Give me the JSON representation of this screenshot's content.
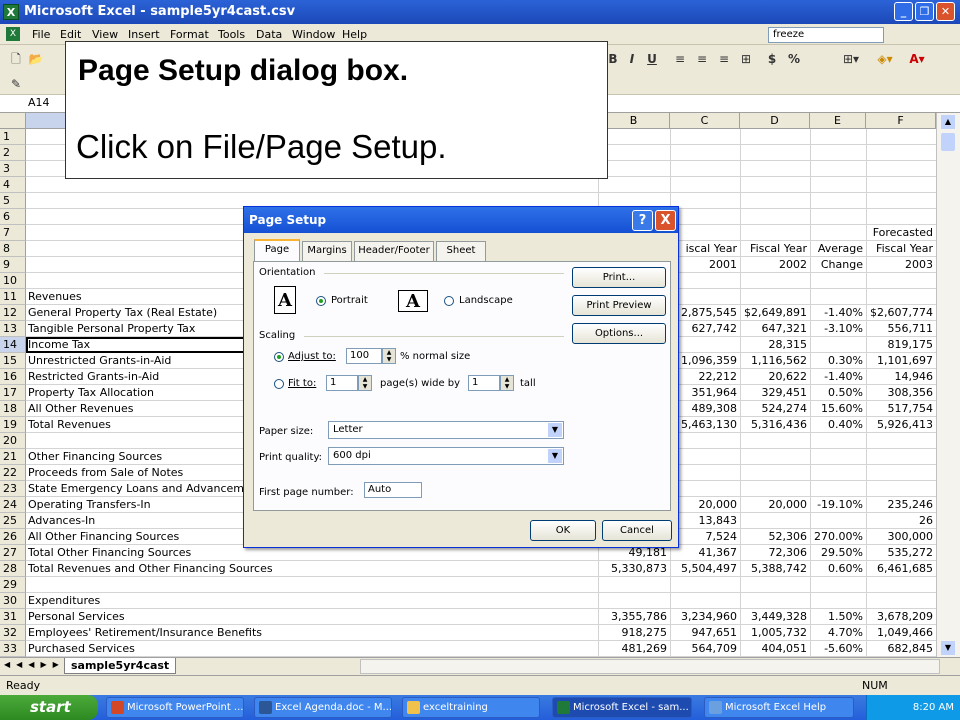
{
  "window": {
    "title": "Microsoft Excel - sample5yr4cast.csv",
    "app_icon": "X"
  },
  "menu": [
    "File",
    "Edit",
    "View",
    "Insert",
    "Format",
    "Tools",
    "Data",
    "Window",
    "Help"
  ],
  "help_box": "freeze",
  "toolbar": {
    "bold": "B",
    "italic": "I",
    "underline": "U",
    "currency": "$",
    "percent": "%"
  },
  "formula_bar": {
    "name_box": "A14"
  },
  "columns": [
    "B",
    "C",
    "D",
    "E",
    "F"
  ],
  "rows": [
    {
      "n": "1",
      "a": "",
      "b": "",
      "c": "",
      "d": "",
      "e": "",
      "f": ""
    },
    {
      "n": "2",
      "a": "",
      "b": "",
      "c": "",
      "d": "",
      "e": "",
      "f": ""
    },
    {
      "n": "3",
      "a": "",
      "b": "",
      "c": "",
      "d": "",
      "e": "",
      "f": ""
    },
    {
      "n": "4",
      "a": "",
      "b": "",
      "c": "",
      "d": "",
      "e": "",
      "f": ""
    },
    {
      "n": "5",
      "a": "",
      "b": "",
      "c": "",
      "d": "",
      "e": "",
      "f": ""
    },
    {
      "n": "6",
      "a": "",
      "b": "",
      "c": "",
      "d": "",
      "e": "",
      "f": ""
    },
    {
      "n": "7",
      "a": "",
      "b": "",
      "c": "",
      "d": "",
      "e": "",
      "f": "Forecasted"
    },
    {
      "n": "8",
      "a": "",
      "b": "",
      "c": "iscal Year",
      "d": "Fiscal Year",
      "e": "Average",
      "f": "Fiscal Year"
    },
    {
      "n": "9",
      "a": "",
      "b": "",
      "c": "2001",
      "d": "2002",
      "e": "Change",
      "f": "2003"
    },
    {
      "n": "10",
      "a": "",
      "b": "",
      "c": "",
      "d": "",
      "e": "",
      "f": ""
    },
    {
      "n": "11",
      "a": "Revenues",
      "b": "",
      "c": "",
      "d": "",
      "e": "",
      "f": ""
    },
    {
      "n": "12",
      "a": "General Property Tax (Real Estate)",
      "b": "",
      "c": "2,875,545",
      "d": "$2,649,891",
      "e": "-1.40%",
      "f": "$2,607,774"
    },
    {
      "n": "13",
      "a": "Tangible Personal Property Tax",
      "b": "",
      "c": "627,742",
      "d": "647,321",
      "e": "-3.10%",
      "f": "556,711"
    },
    {
      "n": "14",
      "a": "Income Tax",
      "b": "",
      "c": "",
      "d": "28,315",
      "e": "",
      "f": "819,175"
    },
    {
      "n": "15",
      "a": "Unrestricted Grants-in-Aid",
      "b": "",
      "c": "1,096,359",
      "d": "1,116,562",
      "e": "0.30%",
      "f": "1,101,697"
    },
    {
      "n": "16",
      "a": "Restricted Grants-in-Aid",
      "b": "",
      "c": "22,212",
      "d": "20,622",
      "e": "-1.40%",
      "f": "14,946"
    },
    {
      "n": "17",
      "a": "Property Tax Allocation",
      "b": "",
      "c": "351,964",
      "d": "329,451",
      "e": "0.50%",
      "f": "308,356"
    },
    {
      "n": "18",
      "a": "All Other Revenues",
      "b": "",
      "c": "489,308",
      "d": "524,274",
      "e": "15.60%",
      "f": "517,754"
    },
    {
      "n": "19",
      "a": "Total Revenues",
      "b": "",
      "c": "5,463,130",
      "d": "5,316,436",
      "e": "0.40%",
      "f": "5,926,413"
    },
    {
      "n": "20",
      "a": "",
      "b": "",
      "c": "",
      "d": "",
      "e": "",
      "f": ""
    },
    {
      "n": "21",
      "a": "Other Financing Sources",
      "b": "",
      "c": "",
      "d": "",
      "e": "",
      "f": ""
    },
    {
      "n": "22",
      "a": "Proceeds from Sale of Notes",
      "b": "",
      "c": "",
      "d": "",
      "e": "",
      "f": ""
    },
    {
      "n": "23",
      "a": "State Emergency Loans and Advancem",
      "b": "",
      "c": "",
      "d": "",
      "e": "",
      "f": ""
    },
    {
      "n": "24",
      "a": "Operating Transfers-In",
      "b": "",
      "c": "20,000",
      "d": "20,000",
      "e": "-19.10%",
      "f": "235,246"
    },
    {
      "n": "25",
      "a": "Advances-In",
      "b": "",
      "c": "13,843",
      "d": "",
      "e": "",
      "f": "26"
    },
    {
      "n": "26",
      "a": "All Other Financing Sources",
      "b": "",
      "c": "7,524",
      "d": "52,306",
      "e": "270.00%",
      "f": "300,000"
    },
    {
      "n": "27",
      "a": "Total Other Financing Sources",
      "b": "49,181",
      "c": "41,367",
      "d": "72,306",
      "e": "29.50%",
      "f": "535,272"
    },
    {
      "n": "28",
      "a": "Total Revenues and Other Financing Sources",
      "b": "5,330,873",
      "c": "5,504,497",
      "d": "5,388,742",
      "e": "0.60%",
      "f": "6,461,685"
    },
    {
      "n": "29",
      "a": "",
      "b": "",
      "c": "",
      "d": "",
      "e": "",
      "f": ""
    },
    {
      "n": "30",
      "a": "Expenditures",
      "b": "",
      "c": "",
      "d": "",
      "e": "",
      "f": ""
    },
    {
      "n": "31",
      "a": "Personal Services",
      "b": "3,355,786",
      "c": "3,234,960",
      "d": "3,449,328",
      "e": "1.50%",
      "f": "3,678,209"
    },
    {
      "n": "32",
      "a": "Employees' Retirement/Insurance Benefits",
      "b": "918,275",
      "c": "947,651",
      "d": "1,005,732",
      "e": "4.70%",
      "f": "1,049,466"
    },
    {
      "n": "33",
      "a": "Purchased Services",
      "b": "481,269",
      "c": "564,709",
      "d": "404,051",
      "e": "-5.60%",
      "f": "682,845"
    }
  ],
  "sheet_tab": "sample5yr4cast",
  "status": {
    "left": "Ready",
    "num": "NUM"
  },
  "annotation": {
    "title": "Page Setup dialog box.",
    "body": "Click on File/Page Setup."
  },
  "dialog": {
    "title": "Page Setup",
    "help_btn": "?",
    "close_btn": "X",
    "tabs": [
      "Page",
      "Margins",
      "Header/Footer",
      "Sheet"
    ],
    "orientation_label": "Orientation",
    "portrait": "Portrait",
    "landscape": "Landscape",
    "orient_glyph": "A",
    "scaling_label": "Scaling",
    "adjust_to": "Adjust to:",
    "adjust_value": "100",
    "normal_size": "% normal size",
    "fit_to": "Fit to:",
    "fit_wide": "1",
    "pages_wide_by": "page(s) wide by",
    "fit_tall": "1",
    "tall": "tall",
    "paper_size_label": "Paper size:",
    "paper_size": "Letter",
    "print_quality_label": "Print quality:",
    "print_quality": "600 dpi",
    "first_page_label": "First page number:",
    "first_page": "Auto",
    "print_btn": "Print...",
    "preview_btn": "Print Preview",
    "options_btn": "Options...",
    "ok_btn": "OK",
    "cancel_btn": "Cancel"
  },
  "taskbar": {
    "start": "start",
    "tasks": [
      "Microsoft PowerPoint ...",
      "Excel Agenda.doc - M...",
      "exceltraining",
      "Microsoft Excel - sam...",
      "Microsoft Excel Help"
    ],
    "clock": "8:20 AM"
  }
}
